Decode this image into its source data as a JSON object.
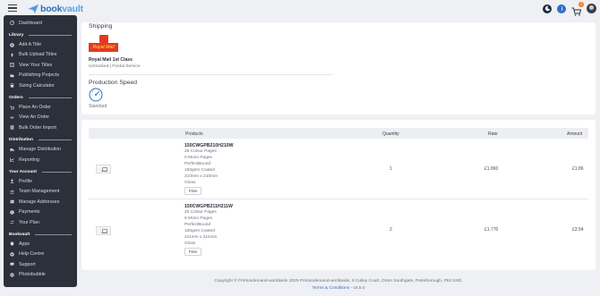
{
  "brand": {
    "name_part1": "book",
    "name_part2": "vault"
  },
  "header": {
    "cart_count": "0",
    "icons": [
      "menu-icon",
      "moon-icon",
      "info-icon",
      "cart-icon",
      "avatar"
    ]
  },
  "sidebar": {
    "top_item": {
      "label": "Dashboard",
      "icon": "dashboard-icon"
    },
    "sections": [
      {
        "heading": "Library",
        "items": [
          {
            "label": "Add A Title",
            "icon": "plus-circle-icon"
          },
          {
            "label": "Bulk Upload Titles",
            "icon": "upload-icon"
          },
          {
            "label": "View Your Titles",
            "icon": "list-icon"
          },
          {
            "label": "Publishing Projects",
            "icon": "project-icon"
          },
          {
            "label": "Sizing Calculator",
            "icon": "calculator-icon"
          }
        ]
      },
      {
        "heading": "Orders",
        "items": [
          {
            "label": "Place An Order",
            "icon": "cart-icon"
          },
          {
            "label": "View An Order",
            "icon": "eye-icon"
          },
          {
            "label": "Bulk Order Import",
            "icon": "import-icon"
          }
        ]
      },
      {
        "heading": "Distribution",
        "items": [
          {
            "label": "Manage Distribution",
            "icon": "truck-icon"
          },
          {
            "label": "Reporting",
            "icon": "chart-icon"
          }
        ]
      },
      {
        "heading": "Your Account",
        "items": [
          {
            "label": "Profile",
            "icon": "user-icon"
          },
          {
            "label": "Team Management",
            "icon": "team-icon"
          },
          {
            "label": "Manage Addresses",
            "icon": "address-icon"
          },
          {
            "label": "Payments",
            "icon": "card-icon"
          },
          {
            "label": "Your Plan",
            "icon": "plan-icon"
          }
        ]
      },
      {
        "heading": "Bookvault",
        "items": [
          {
            "label": "Apps",
            "icon": "apps-icon"
          },
          {
            "label": "Help Centre",
            "icon": "help-icon"
          },
          {
            "label": "Support",
            "icon": "support-icon"
          },
          {
            "label": "Photobubble",
            "icon": "photo-icon"
          }
        ]
      }
    ]
  },
  "shipping": {
    "title": "Shipping",
    "carrier_logo_text": "Royal Mail",
    "method_name": "Royal Mail 1st Class",
    "method_sub": "Untracked | Postal Service"
  },
  "production": {
    "title": "Production Speed",
    "speed": "Standard"
  },
  "order_table": {
    "headers": {
      "products": "Products",
      "quantity": "Quantity",
      "rate": "Rate",
      "amount": "Amount"
    },
    "thumb_text": "IMAGE",
    "files_label": "Files",
    "rows": [
      {
        "sku": "150CWGPB210H210W",
        "specs": [
          "26 Colour Pages",
          "0 Mono Pages",
          "PerfectBound",
          "150gsm Coated",
          "210mm x 210mm",
          "Gloss"
        ],
        "quantity": "1",
        "rate": "£1.860",
        "amount": "£1.86"
      },
      {
        "sku": "150CWGPB211H211W",
        "specs": [
          "20 Colour Pages",
          "6 Mono Pages",
          "PerfectBound",
          "150gsm Coated",
          "211mm x 211mm",
          "Gloss"
        ],
        "quantity": "2",
        "rate": "£1.770",
        "amount": "£3.54"
      }
    ]
  },
  "footer": {
    "copyright": "Copyright © Printondemand-worldwide 2025 Printondemand-worldwide, 9 Culley Court, Orton Southgate, Peterborough, PE2 6XD.",
    "terms": "Terms & Conditions",
    "version": " - v3.5.0"
  }
}
